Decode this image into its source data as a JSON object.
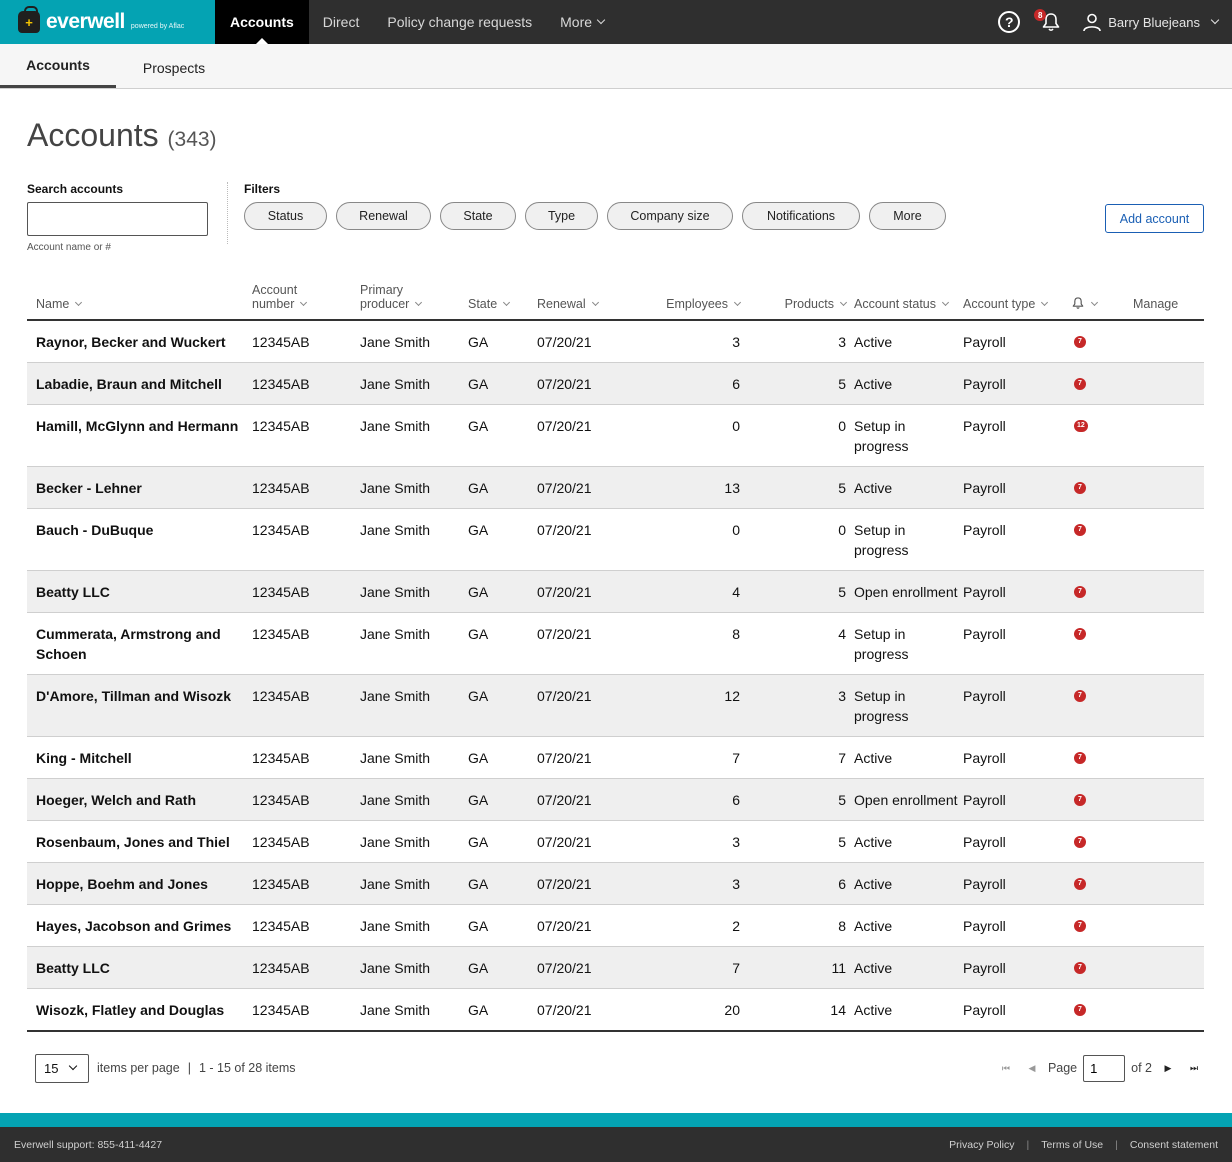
{
  "brand": {
    "name": "everwell",
    "sub": "powered by Aflac",
    "logo_glyph": "+"
  },
  "nav": {
    "items": [
      {
        "label": "Accounts",
        "active": true
      },
      {
        "label": "Direct"
      },
      {
        "label": "Policy change requests"
      },
      {
        "label": "More"
      }
    ],
    "help_glyph": "?",
    "notification_count": "8",
    "user_name": "Barry Bluejeans"
  },
  "subtabs": [
    {
      "label": "Accounts"
    },
    {
      "label": "Prospects"
    }
  ],
  "page": {
    "title": "Accounts",
    "count": "(343)"
  },
  "search": {
    "label": "Search accounts",
    "placeholder": "",
    "hint": "Account name or #"
  },
  "filters": {
    "label": "Filters",
    "chips": [
      "Status",
      "Renewal",
      "State",
      "Type",
      "Company size",
      "Notifications",
      "More"
    ]
  },
  "add_account_label": "Add account",
  "table": {
    "headers": {
      "name": "Name",
      "account_number_1": "Account",
      "account_number_2": "number",
      "producer_1": "Primary",
      "producer_2": "producer",
      "state": "State",
      "renewal": "Renewal",
      "employees": "Employees",
      "products": "Products",
      "status": "Account status",
      "type": "Account type",
      "manage": "Manage"
    },
    "rows": [
      {
        "name": "Raynor, Becker and Wuckert",
        "acct": "12345AB",
        "producer": "Jane Smith",
        "state": "GA",
        "renewal": "07/20/21",
        "employees": "3",
        "products": "3",
        "status": "Active",
        "type": "Payroll",
        "notif": "7"
      },
      {
        "name": "Labadie, Braun and Mitchell",
        "acct": "12345AB",
        "producer": "Jane Smith",
        "state": "GA",
        "renewal": "07/20/21",
        "employees": "6",
        "products": "5",
        "status": "Active",
        "type": "Payroll",
        "notif": "7"
      },
      {
        "name": "Hamill, McGlynn and Hermann",
        "acct": "12345AB",
        "producer": "Jane Smith",
        "state": "GA",
        "renewal": "07/20/21",
        "employees": "0",
        "products": "0",
        "status": "Setup in progress",
        "type": "Payroll",
        "notif": "12"
      },
      {
        "name": "Becker - Lehner",
        "acct": "12345AB",
        "producer": "Jane Smith",
        "state": "GA",
        "renewal": "07/20/21",
        "employees": "13",
        "products": "5",
        "status": "Active",
        "type": "Payroll",
        "notif": "7"
      },
      {
        "name": "Bauch - DuBuque",
        "acct": "12345AB",
        "producer": "Jane Smith",
        "state": "GA",
        "renewal": "07/20/21",
        "employees": "0",
        "products": "0",
        "status": "Setup in progress",
        "type": "Payroll",
        "notif": "7"
      },
      {
        "name": "Beatty LLC",
        "acct": "12345AB",
        "producer": "Jane Smith",
        "state": "GA",
        "renewal": "07/20/21",
        "employees": "4",
        "products": "5",
        "status": "Open enrollment",
        "type": "Payroll",
        "notif": "7"
      },
      {
        "name": "Cummerata, Armstrong and Schoen",
        "acct": "12345AB",
        "producer": "Jane Smith",
        "state": "GA",
        "renewal": "07/20/21",
        "employees": "8",
        "products": "4",
        "status": "Setup in progress",
        "type": "Payroll",
        "notif": "7"
      },
      {
        "name": "D'Amore, Tillman and Wisozk",
        "acct": "12345AB",
        "producer": "Jane Smith",
        "state": "GA",
        "renewal": "07/20/21",
        "employees": "12",
        "products": "3",
        "status": "Setup in progress",
        "type": "Payroll",
        "notif": "7"
      },
      {
        "name": "King - Mitchell",
        "acct": "12345AB",
        "producer": "Jane Smith",
        "state": "GA",
        "renewal": "07/20/21",
        "employees": "7",
        "products": "7",
        "status": "Active",
        "type": "Payroll",
        "notif": "7"
      },
      {
        "name": "Hoeger, Welch and Rath",
        "acct": "12345AB",
        "producer": "Jane Smith",
        "state": "GA",
        "renewal": "07/20/21",
        "employees": "6",
        "products": "5",
        "status": "Open enrollment",
        "type": "Payroll",
        "notif": "7"
      },
      {
        "name": "Rosenbaum, Jones and Thiel",
        "acct": "12345AB",
        "producer": "Jane Smith",
        "state": "GA",
        "renewal": "07/20/21",
        "employees": "3",
        "products": "5",
        "status": "Active",
        "type": "Payroll",
        "notif": "7"
      },
      {
        "name": "Hoppe, Boehm and Jones",
        "acct": "12345AB",
        "producer": "Jane Smith",
        "state": "GA",
        "renewal": "07/20/21",
        "employees": "3",
        "products": "6",
        "status": "Active",
        "type": "Payroll",
        "notif": "7"
      },
      {
        "name": "Hayes, Jacobson and Grimes",
        "acct": "12345AB",
        "producer": "Jane Smith",
        "state": "GA",
        "renewal": "07/20/21",
        "employees": "2",
        "products": "8",
        "status": "Active",
        "type": "Payroll",
        "notif": "7"
      },
      {
        "name": "Beatty LLC",
        "acct": "12345AB",
        "producer": "Jane Smith",
        "state": "GA",
        "renewal": "07/20/21",
        "employees": "7",
        "products": "11",
        "status": "Active",
        "type": "Payroll",
        "notif": "7"
      },
      {
        "name": "Wisozk, Flatley and Douglas",
        "acct": "12345AB",
        "producer": "Jane Smith",
        "state": "GA",
        "renewal": "07/20/21",
        "employees": "20",
        "products": "14",
        "status": "Active",
        "type": "Payroll",
        "notif": "7"
      }
    ]
  },
  "pagination": {
    "per_page": "15",
    "per_page_label": "items per page",
    "separator": "|",
    "range": "1 - 15 of 28 items",
    "page_label": "Page",
    "page_value": "1",
    "of_label": "of 2",
    "first_glyph": "⏮",
    "prev_glyph": "◀",
    "next_glyph": "▶",
    "last_glyph": "⏭"
  },
  "footer": {
    "support": "Everwell support: 855-411-4427",
    "links": [
      "Privacy Policy",
      "Terms of Use",
      "Consent statement"
    ],
    "separator": "|"
  },
  "colors": {
    "brand": "#04a3b3",
    "nav_bg": "#2f2f2f",
    "accent_blue": "#1a5fb4",
    "alert_red": "#c62828"
  }
}
